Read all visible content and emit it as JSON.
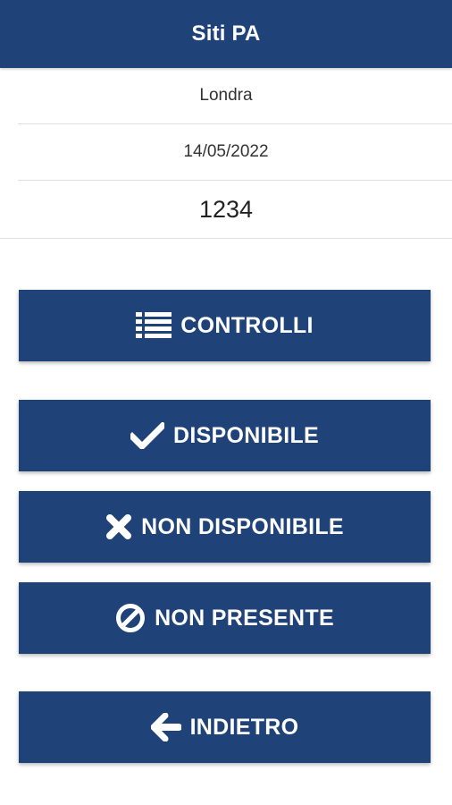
{
  "header": {
    "title": "Siti PA",
    "background": "#1f4278"
  },
  "info": {
    "city": "Londra",
    "date": "14/05/2022",
    "code": "1234"
  },
  "buttons": {
    "controlli": {
      "label": "CONTROLLI",
      "icon": "list-icon"
    },
    "disponibile": {
      "label": "DISPONIBILE",
      "icon": "check-icon"
    },
    "non_disponibile": {
      "label": "NON DISPONIBILE",
      "icon": "close-icon"
    },
    "non_presente": {
      "label": "NON PRESENTE",
      "icon": "ban-icon"
    },
    "indietro": {
      "label": "INDIETRO",
      "icon": "arrow-left-icon"
    }
  },
  "colors": {
    "primary": "#1f4278",
    "button_text": "#ffffff",
    "divider": "#e0e0e0"
  }
}
